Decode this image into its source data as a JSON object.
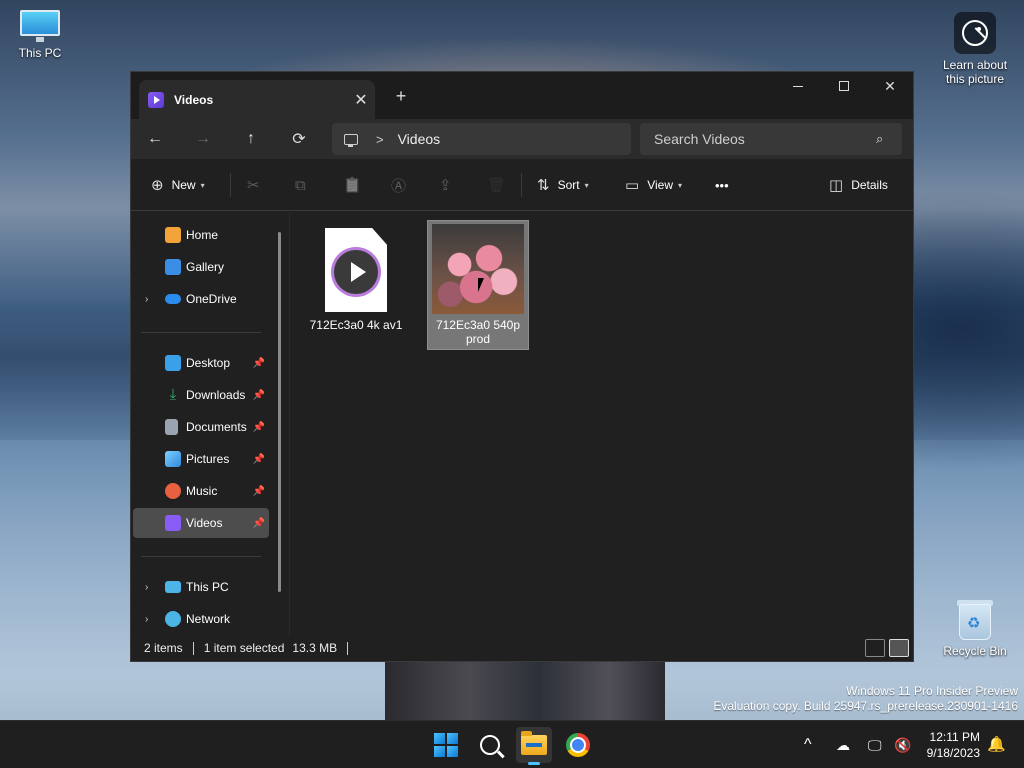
{
  "desktop": {
    "icons": [
      {
        "label": "This PC",
        "icon": "monitor-icon"
      },
      {
        "label": "Learn about this picture",
        "icon": "camera-spotlight-icon"
      },
      {
        "label": "Recycle Bin",
        "icon": "recycle-bin-icon"
      }
    ],
    "watermark": {
      "line1": "Windows 11 Pro Insider Preview",
      "line2": "Evaluation copy. Build 25947.rs_prerelease.230901-1416"
    }
  },
  "window": {
    "tab_title": "Videos",
    "tab_close": "✕",
    "new_tab": "+",
    "caption": {
      "minimize": "minimize",
      "maximize": "maximize",
      "close": "✕"
    },
    "navigation": {
      "back": "←",
      "forward": "→",
      "up": "↑",
      "refresh": "⟳"
    },
    "address": {
      "separator": ">",
      "crumb": "Videos"
    },
    "search": {
      "placeholder": "Search Videos",
      "icon": "⌕"
    },
    "commandbar": {
      "new_label": "New",
      "sort_label": "Sort",
      "view_label": "View",
      "more_label": "•••",
      "details_label": "Details",
      "cut_icon": "✂",
      "copy_icon": "⧉",
      "paste_icon": "📋",
      "rename_icon": "Ⓐ",
      "share_icon": "⇪",
      "delete_icon": "🗑"
    },
    "sidebar": {
      "items": [
        {
          "label": "Home",
          "icon": "home-icon",
          "color": "#f2a33a"
        },
        {
          "label": "Gallery",
          "icon": "gallery-icon",
          "color": "#3a8ee6"
        },
        {
          "label": "OneDrive",
          "icon": "onedrive-icon",
          "color": "#2b8cf0"
        },
        {
          "label": "Desktop",
          "icon": "desktop-icon",
          "color": "#3aa0e8"
        },
        {
          "label": "Downloads",
          "icon": "downloads-icon",
          "color": "#2fb36a"
        },
        {
          "label": "Documents",
          "icon": "documents-icon",
          "color": "#9aa4b0"
        },
        {
          "label": "Pictures",
          "icon": "pictures-icon",
          "color": "#3fa5e6"
        },
        {
          "label": "Music",
          "icon": "music-icon",
          "color": "#e7603f"
        },
        {
          "label": "Videos",
          "icon": "videos-icon",
          "color": "#8a5cf6"
        },
        {
          "label": "This PC",
          "icon": "this-pc-icon",
          "color": "#4db4e8"
        },
        {
          "label": "Network",
          "icon": "network-icon",
          "color": "#4db4e8"
        }
      ],
      "pin_glyph": "📌",
      "expand_glyph": "›"
    },
    "files": [
      {
        "name": "712Ec3a0 4k av1",
        "type": "video-file-icon",
        "selected": false
      },
      {
        "name": "712Ec3a0 540p prod",
        "type": "video-thumbnail",
        "selected": true
      }
    ],
    "status": {
      "items_count": "2 items",
      "selection": "1 item selected",
      "size": "13.3 MB"
    }
  },
  "taskbar": {
    "apps": [
      "start-icon",
      "search-icon",
      "file-explorer-icon",
      "chrome-icon"
    ],
    "tray": {
      "chevron": "^",
      "time": "12:11 PM",
      "date": "9/18/2023"
    },
    "accent": "#4cc2ff"
  }
}
